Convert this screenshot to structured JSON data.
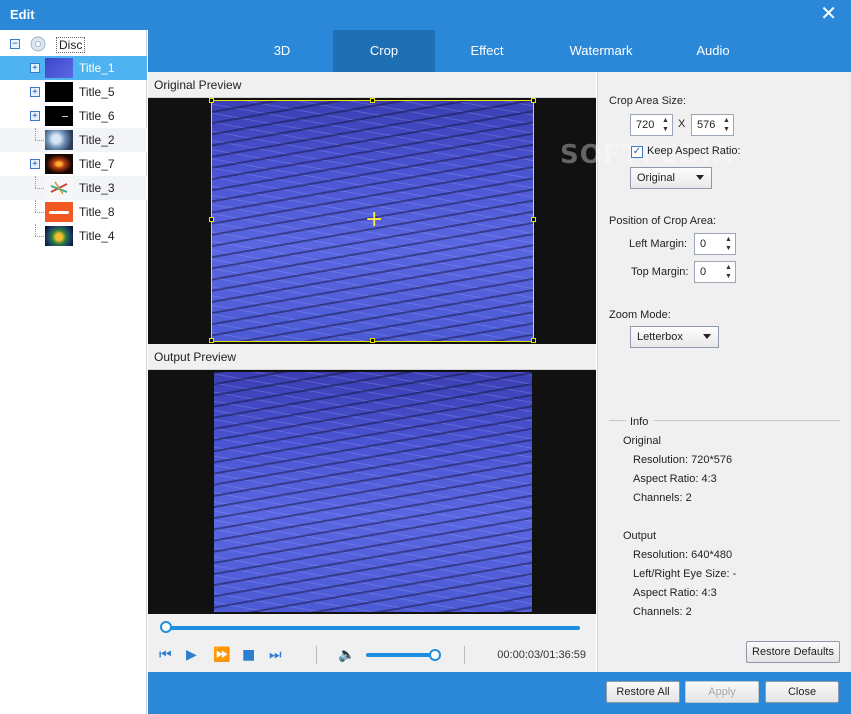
{
  "window": {
    "title": "Edit",
    "close_glyph": "✕"
  },
  "tree": {
    "disc_label": "Disc",
    "expand_glyph": "+",
    "collapse_glyph": "−",
    "items": [
      {
        "label": "Title_1",
        "selected": true,
        "expandable": true
      },
      {
        "label": "Title_5",
        "expandable": true
      },
      {
        "label": "Title_6",
        "expandable": true
      },
      {
        "label": "Title_2",
        "expandable": false
      },
      {
        "label": "Title_7",
        "expandable": true
      },
      {
        "label": "Title_3",
        "expandable": false
      },
      {
        "label": "Title_8",
        "expandable": false
      },
      {
        "label": "Title_4",
        "expandable": false
      }
    ]
  },
  "tabs": [
    {
      "label": "3D"
    },
    {
      "label": "Crop",
      "active": true
    },
    {
      "label": "Effect"
    },
    {
      "label": "Watermark"
    },
    {
      "label": "Audio"
    }
  ],
  "preview": {
    "original_label": "Original Preview",
    "output_label": "Output Preview",
    "crosshair_glyph": "+"
  },
  "playback": {
    "timecode": "00:00:03/01:36:59",
    "progress_fraction": 0.0,
    "volume_fraction": 1.0,
    "icons": [
      "prev-frame-icon",
      "play-icon",
      "fast-forward-icon",
      "stop-icon",
      "next-frame-icon",
      "volume-icon"
    ],
    "glyphs": {
      "prev": "⏮",
      "play": "▶",
      "ff": "⏩",
      "stop": "■",
      "next": "⏭",
      "vol": "🔈"
    }
  },
  "crop": {
    "area_size_label": "Crop Area Size:",
    "width": "720",
    "x_sep": "X",
    "height": "576",
    "keep_aspect_label": "Keep Aspect Ratio:",
    "keep_aspect_checked": true,
    "aspect_value": "Original",
    "position_label": "Position of Crop Area:",
    "left_margin_label": "Left Margin:",
    "left_margin": "0",
    "top_margin_label": "Top Margin:",
    "top_margin": "0",
    "zoom_mode_label": "Zoom Mode:",
    "zoom_mode": "Letterbox",
    "spin_up": "▲",
    "spin_down": "▼",
    "check_glyph": "✓"
  },
  "info": {
    "group_label": "Info",
    "original_heading": "Original",
    "original_resolution": "Resolution: 720*576",
    "original_aspect": "Aspect Ratio: 4:3",
    "original_channels": "Channels: 2",
    "output_heading": "Output",
    "output_resolution": "Resolution: 640*480",
    "output_eye": "Left/Right Eye Size: -",
    "output_aspect": "Aspect Ratio: 4:3",
    "output_channels": "Channels: 2"
  },
  "buttons": {
    "restore_defaults": "Restore Defaults",
    "restore_all": "Restore All",
    "apply": "Apply",
    "close": "Close"
  },
  "watermark_text": "SOFTPEDIA"
}
